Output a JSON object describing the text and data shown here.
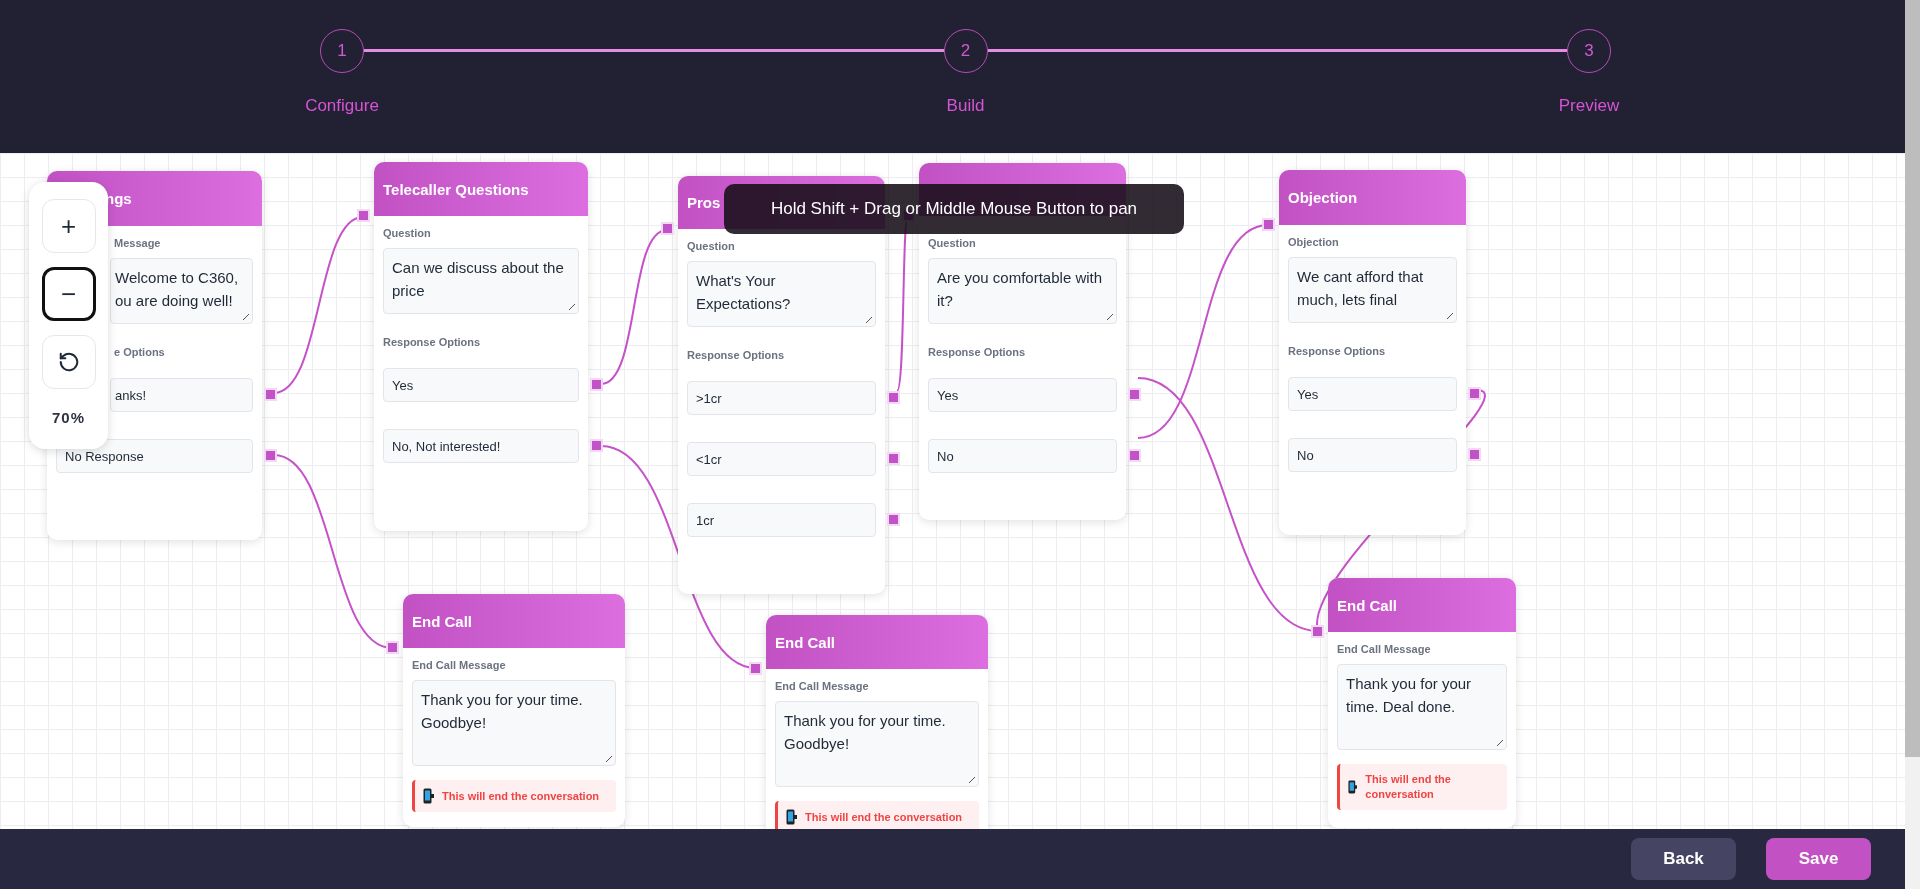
{
  "stepper": [
    {
      "number": "1",
      "label": "Configure"
    },
    {
      "number": "2",
      "label": "Build"
    },
    {
      "number": "3",
      "label": "Preview"
    }
  ],
  "nodes": [
    {
      "kind": "question",
      "title": "ngs",
      "field_label": "Message",
      "text": "Welcome to C360, ou are doing well!",
      "options_label": "e Options",
      "options": [
        "anks!",
        "No Response"
      ]
    },
    {
      "kind": "question",
      "title": "Telecaller Questions",
      "field_label": "Question",
      "text": "Can we discuss about the price",
      "options_label": "Response Options",
      "options": [
        "Yes",
        "No, Not interested!"
      ]
    },
    {
      "kind": "question",
      "title": "Pros",
      "field_label": "Question",
      "text": "What's Your Expectations?",
      "options_label": "Response Options",
      "options": [
        ">1cr",
        "<1cr",
        "1cr"
      ]
    },
    {
      "kind": "question",
      "field_label": "Question",
      "text": "Are you comfortable with it?",
      "options_label": "Response Options",
      "options": [
        "Yes",
        "No"
      ]
    },
    {
      "kind": "question",
      "title": "Objection",
      "field_label": "Objection",
      "text": "We cant afford that much, lets final",
      "options_label": "Response Options",
      "options": [
        "Yes",
        "No"
      ]
    },
    {
      "kind": "end_call",
      "title": "End Call",
      "field_label": "End Call Message",
      "text": "Thank you for your time. Goodbye!",
      "warning": "This will end the conversation"
    },
    {
      "kind": "end_call",
      "title": "End Call",
      "field_label": "End Call Message",
      "text": "Thank you for your time. Goodbye!",
      "warning": "This will end the conversation"
    },
    {
      "kind": "end_call",
      "title": "End Call",
      "field_label": "End Call Message",
      "text": "Thank you for your time. Deal done.",
      "warning": "This will end the conversation"
    }
  ],
  "zoom_controls": {
    "buttons": [
      {
        "kind": "zoom_in",
        "label": "+",
        "focused": false
      },
      {
        "kind": "zoom_out",
        "label": "−",
        "focused": true
      },
      {
        "kind": "reset",
        "focused": false
      }
    ],
    "level": "70%"
  },
  "tooltip": "Hold Shift + Drag or Middle Mouse Button to pan",
  "footer_buttons": [
    {
      "kind": "secondary",
      "label": "Back"
    },
    {
      "kind": "primary",
      "label": "Save"
    }
  ]
}
